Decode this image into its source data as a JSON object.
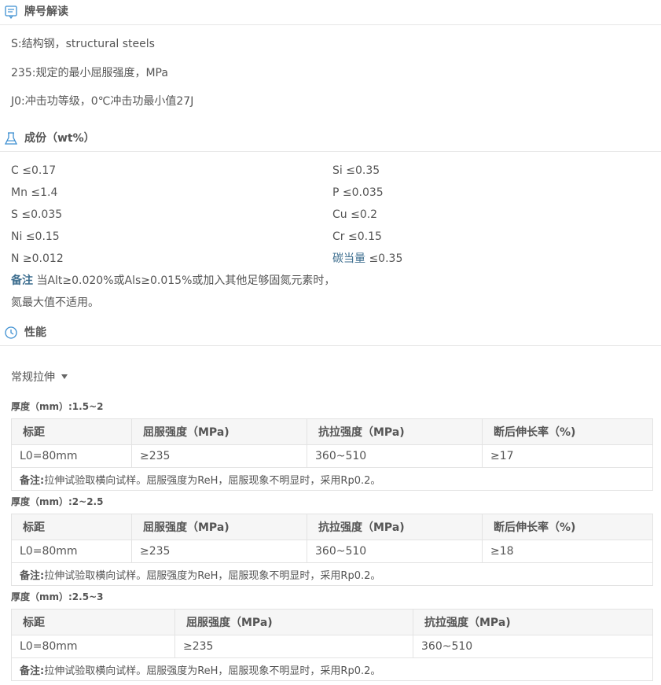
{
  "sections": {
    "designation": {
      "title": "牌号解读",
      "icon": "document-icon"
    },
    "composition": {
      "title": "成份（wt%）",
      "icon": "flask-icon"
    },
    "performance": {
      "title": "性能",
      "icon": "gauge-icon"
    }
  },
  "designation_lines": [
    "S:结构钢，structural steels",
    "235:规定的最小屈服强度，MPa",
    "J0:冲击功等级，0℃冲击功最小值27J"
  ],
  "composition": {
    "left": [
      "C ≤0.17",
      "Mn ≤1.4",
      "S ≤0.035",
      "Ni ≤0.15",
      "N ≥0.012"
    ],
    "right": [
      "Si ≤0.35",
      "P ≤0.035",
      "Cu ≤0.2",
      "Cr ≤0.15"
    ],
    "ceq_label": "碳当量",
    "ceq_value": "≤0.35",
    "note_label": "备注",
    "note_line1": "当Alt≥0.020%或Als≥0.015%或加入其他足够固氮元素时，",
    "note_line2": "氮最大值不适用。"
  },
  "test_selector": {
    "selected": "常规拉伸"
  },
  "tables": [
    {
      "thickness": "厚度（mm）:1.5~2",
      "headers": [
        "标距",
        "屈服强度（MPa)",
        "抗拉强度（MPa)",
        "断后伸长率（%)"
      ],
      "row": [
        "L0=80mm",
        "≥235",
        "360~510",
        "≥17"
      ],
      "note_label": "备注:",
      "note_text": "拉伸试验取横向试样。屈服强度为ReH，屈服现象不明显时，采用Rp0.2。"
    },
    {
      "thickness": "厚度（mm）:2~2.5",
      "headers": [
        "标距",
        "屈服强度（MPa)",
        "抗拉强度（MPa)",
        "断后伸长率（%)"
      ],
      "row": [
        "L0=80mm",
        "≥235",
        "360~510",
        "≥18"
      ],
      "note_label": "备注:",
      "note_text": "拉伸试验取横向试样。屈服强度为ReH，屈服现象不明显时，采用Rp0.2。"
    },
    {
      "thickness": "厚度（mm）:2.5~3",
      "headers": [
        "标距",
        "屈服强度（MPa)",
        "抗拉强度（MPa)"
      ],
      "row": [
        "L0=80mm",
        "≥235",
        "360~510"
      ],
      "note_label": "备注:",
      "note_text": "拉伸试验取横向试样。屈服强度为ReH，屈服现象不明显时，采用Rp0.2。"
    }
  ],
  "colors": {
    "accent": "#3d6e8f",
    "header_bg": "#f6f6f6",
    "border": "#e3e3e3"
  }
}
